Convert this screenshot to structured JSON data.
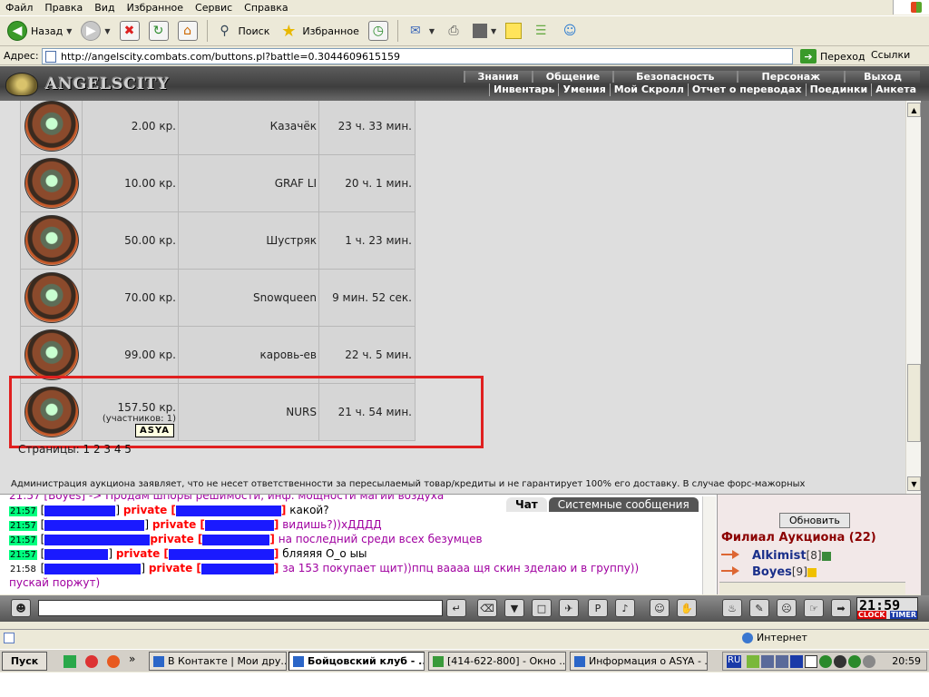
{
  "menu": [
    "Файл",
    "Правка",
    "Вид",
    "Избранное",
    "Сервис",
    "Справка"
  ],
  "toolbar": {
    "back": "Назад",
    "search": "Поиск",
    "favorites": "Избранное"
  },
  "address": {
    "label": "Адрес:",
    "url": "http://angelscity.combats.com/buttons.pl?battle=0.3044609615159",
    "go": "Переход",
    "links": "Ссылки"
  },
  "game": {
    "logo": "ANGELSCITY",
    "nav_top": [
      "Знания",
      "Общение",
      "Безопасность",
      "Персонаж",
      "Выход"
    ],
    "nav_bottom": [
      "Инвентарь",
      "Умения",
      "Мой Скролл",
      "Отчет о переводах",
      "Поединки",
      "Анкета"
    ]
  },
  "lots": [
    {
      "price": "2.00 кр.",
      "name": "Казачёк",
      "time": "23 ч. 33 мин."
    },
    {
      "price": "10.00 кр.",
      "name": "GRAF LI",
      "time": "20 ч. 1 мин."
    },
    {
      "price": "50.00 кр.",
      "name": "Шустряк",
      "time": "1 ч. 23 мин."
    },
    {
      "price": "70.00 кр.",
      "name": "Snowqueen",
      "time": "9 мин. 52 сек."
    },
    {
      "price": "99.00 кр.",
      "name": "каровь-ев",
      "time": "22 ч. 5 мин."
    },
    {
      "price": "157.50 кр.",
      "sub": "(участников: 1)",
      "name": "NURS",
      "time": "21 ч. 54 мин."
    }
  ],
  "tooltip": "ASYA",
  "pages": {
    "label": "Страницы:",
    "nums": "1 2 3 4 5"
  },
  "notice": "Администрация аукциона заявляет, что не несет ответственности за пересылаемый товар/кредиты и не гарантирует 100% его доставку. В случае форс-мажорных",
  "chat": {
    "tabs": [
      "Чат",
      "Системные сообщения"
    ],
    "partial": "21:57 [Boyes] -> Продам шпоры решимости, инф. мощности магии воздуха",
    "lines": [
      {
        "time": "21:57",
        "priv": "private [",
        "msg": "какой?",
        "dark": true
      },
      {
        "time": "21:57",
        "priv": "private [",
        "msg": "видишь?))хДДДД",
        "dark": false
      },
      {
        "time": "21:57",
        "priv": "private [",
        "msg": "на последний среди всех безумцев",
        "dark": false
      },
      {
        "time": "21:57",
        "priv": "private [",
        "msg": "бляяяя О_о ыы",
        "dark": true
      },
      {
        "time": "21:58",
        "priv": "private [",
        "msg": "за 153 покупает щит))ппц вааaa щя скин зделаю и в группу))",
        "dark": false
      }
    ],
    "wrap": "пускай поржут)"
  },
  "users": {
    "refresh": "Обновить",
    "title": "Филиал Аукциона (22)",
    "list": [
      {
        "name": "Alkimist",
        "level": "[8]"
      },
      {
        "name": "Boyes",
        "level": "[9]"
      }
    ]
  },
  "clock": {
    "time": "21:59",
    "l1": "CLOCK",
    "l2": "TIMER"
  },
  "status": {
    "zone": "Интернет"
  },
  "taskbar": {
    "start": "Пуск",
    "tasks": [
      "В Контакте | Мои дру...",
      "Бойцовский клуб - ...",
      "[414-622-800] - Окно ...",
      "Информация о ASYA - ..."
    ],
    "lang": "RU",
    "time": "20:59"
  }
}
